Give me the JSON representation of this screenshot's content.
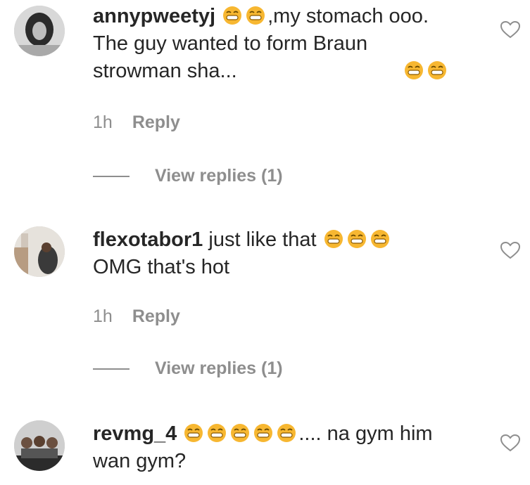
{
  "comments": [
    {
      "username": "annypweetyj",
      "emoji_lead": 2,
      "text_line1": ",my stomach ooo.",
      "text_rest": "The guy wanted to form Braun strowman sha...",
      "emoji_tail": 2,
      "time": "1h",
      "reply_label": "Reply",
      "view_replies": "View replies (1)"
    },
    {
      "username": "flexotabor1",
      "text_line1": "just like that",
      "emoji_tail_line1": 3,
      "text_rest": "OMG that's hot",
      "time": "1h",
      "reply_label": "Reply",
      "view_replies": "View replies (1)"
    },
    {
      "username": "revmg_4",
      "emoji_lead": 5,
      "text_line1": ".... na gym him",
      "text_rest": "wan gym?"
    }
  ],
  "colors": {
    "text": "#262626",
    "muted": "#8e8e8e",
    "emoji": "#f7b731"
  }
}
